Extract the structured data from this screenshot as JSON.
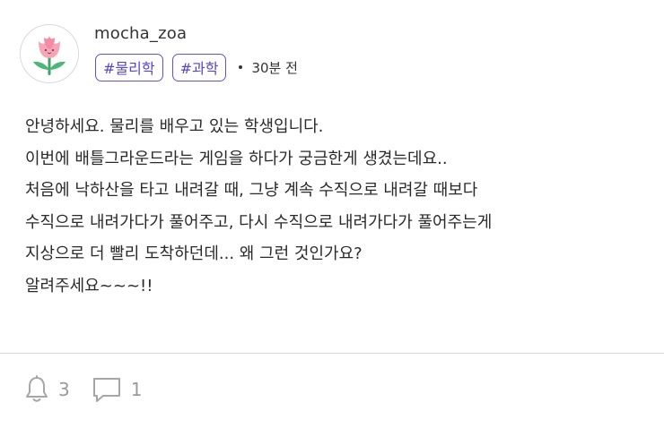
{
  "post": {
    "author": {
      "username": "mocha_zoa",
      "avatar_icon": "tulip-icon"
    },
    "tags": [
      "#물리학",
      "#과학"
    ],
    "time": "30분 전",
    "body_lines": [
      "안녕하세요. 물리를 배우고 있는 학생입니다.",
      "이번에 배틀그라운드라는 게임을 하다가 궁금한게 생겼는데요..",
      "처음에 낙하산을 타고 내려갈 때, 그냥 계속 수직으로 내려갈 때보다",
      "수직으로 내려가다가 풀어주고, 다시 수직으로 내려가다가 풀어주는게",
      "지상으로 더 빨리 도착하던데... 왜 그런 것인가요?",
      "알려주세요~~~!!"
    ]
  },
  "actions": {
    "like": {
      "icon": "bell-icon",
      "count": "3"
    },
    "comment": {
      "icon": "comment-icon",
      "count": "1"
    }
  },
  "colors": {
    "tag_border": "#6552c9",
    "tag_text": "#5a46c2",
    "icon_gray": "#a6a6a6"
  }
}
